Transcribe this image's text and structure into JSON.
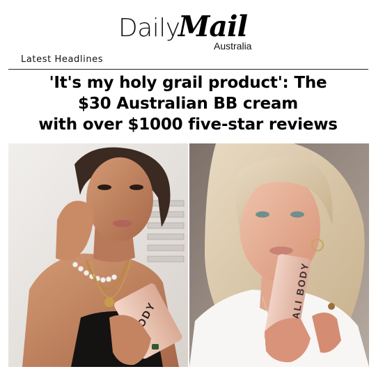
{
  "masthead": {
    "brand_daily": "Daily",
    "brand_mail": "Mail",
    "brand_region": "Australia"
  },
  "section": {
    "label": "Latest Headlines"
  },
  "article": {
    "headline_lines": [
      "'It's my holy grail product': The",
      "$30 Australian BB cream",
      "with over $1000 five-star reviews"
    ]
  },
  "images": {
    "left_product_text": "YBODY",
    "right_product_text": "BALI BODY"
  },
  "colors": {
    "text": "#000000",
    "rule": "#222222",
    "skin": "#d9a07f",
    "tube": "#e8c1ae"
  }
}
